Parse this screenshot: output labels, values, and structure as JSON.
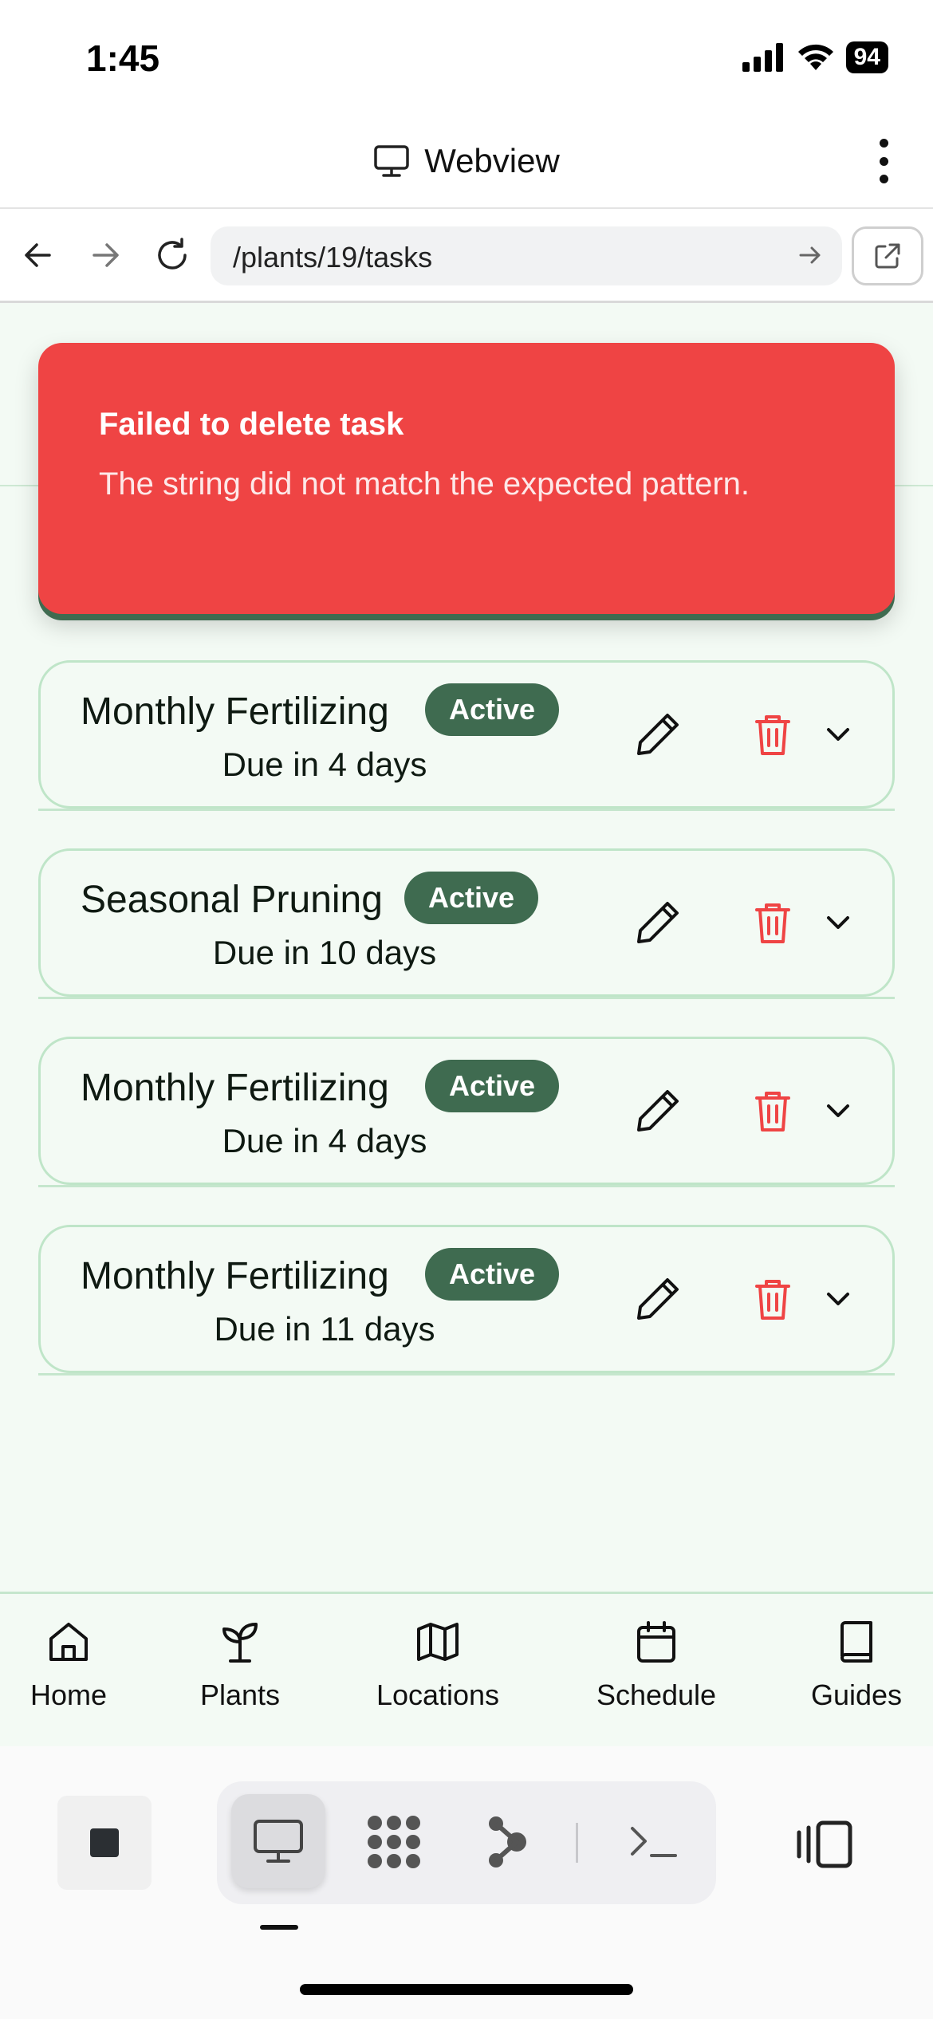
{
  "status_bar": {
    "time": "1:45",
    "battery": "94"
  },
  "webview": {
    "title": "Webview"
  },
  "browser": {
    "url": "/plants/19/tasks"
  },
  "toast": {
    "title": "Failed to delete task",
    "message": "The string did not match the expected pattern."
  },
  "tasks": [
    {
      "title": "Monthly Fertilizing",
      "status": "Active",
      "due": "Due in 4 days"
    },
    {
      "title": "Seasonal Pruning",
      "status": "Active",
      "due": "Due in 10 days"
    },
    {
      "title": "Monthly Fertilizing",
      "status": "Active",
      "due": "Due in 4 days"
    },
    {
      "title": "Monthly Fertilizing",
      "status": "Active",
      "due": "Due in 11 days"
    }
  ],
  "tabs": [
    {
      "label": "Home",
      "icon": "home-icon"
    },
    {
      "label": "Plants",
      "icon": "sprout-icon"
    },
    {
      "label": "Locations",
      "icon": "map-icon"
    },
    {
      "label": "Schedule",
      "icon": "calendar-icon"
    },
    {
      "label": "Guides",
      "icon": "book-icon"
    }
  ],
  "colors": {
    "accent": "#3f6b50",
    "danger": "#ef4444",
    "background": "#f3faf4",
    "card_border": "#bfe5c8"
  }
}
